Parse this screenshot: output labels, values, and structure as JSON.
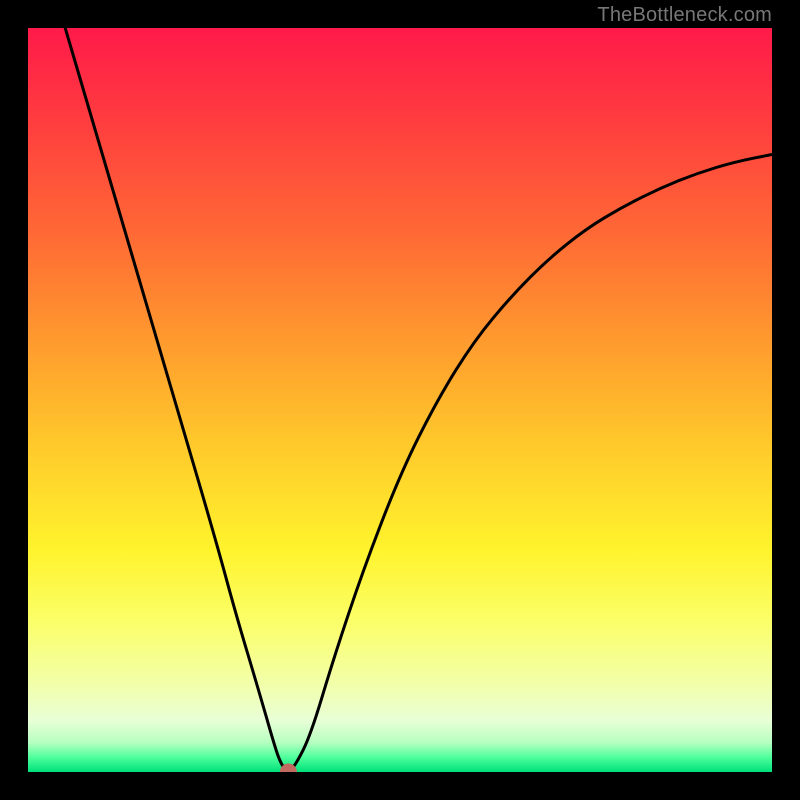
{
  "watermark": "TheBottleneck.com",
  "chart_data": {
    "type": "line",
    "title": "",
    "xlabel": "",
    "ylabel": "",
    "xlim": [
      0,
      100
    ],
    "ylim": [
      0,
      100
    ],
    "grid": false,
    "legend": false,
    "series": [
      {
        "name": "curve",
        "x": [
          5,
          10,
          15,
          20,
          25,
          28,
          31,
          33,
          34,
          35,
          36,
          38,
          41,
          45,
          50,
          55,
          60,
          65,
          70,
          75,
          80,
          85,
          90,
          95,
          100
        ],
        "y": [
          100,
          83,
          66,
          49,
          32,
          21,
          11,
          4,
          1,
          0,
          1,
          5,
          15,
          27,
          40,
          50,
          58,
          64,
          69,
          73,
          76,
          78.5,
          80.5,
          82,
          83
        ]
      }
    ],
    "marker": {
      "x": 35,
      "y": 0,
      "color": "#c26a5f",
      "radius_px": 8
    },
    "gradient_stops": [
      {
        "pos": 0.0,
        "color": "#ff1a4a"
      },
      {
        "pos": 0.12,
        "color": "#ff3b3f"
      },
      {
        "pos": 0.28,
        "color": "#ff6a35"
      },
      {
        "pos": 0.42,
        "color": "#ff9a2e"
      },
      {
        "pos": 0.56,
        "color": "#ffc92b"
      },
      {
        "pos": 0.7,
        "color": "#fff32c"
      },
      {
        "pos": 0.8,
        "color": "#fbff6a"
      },
      {
        "pos": 0.88,
        "color": "#f2ffa8"
      },
      {
        "pos": 0.93,
        "color": "#e9ffd6"
      },
      {
        "pos": 0.96,
        "color": "#b8ffc2"
      },
      {
        "pos": 0.98,
        "color": "#4fff9c"
      },
      {
        "pos": 1.0,
        "color": "#00e07a"
      }
    ]
  }
}
